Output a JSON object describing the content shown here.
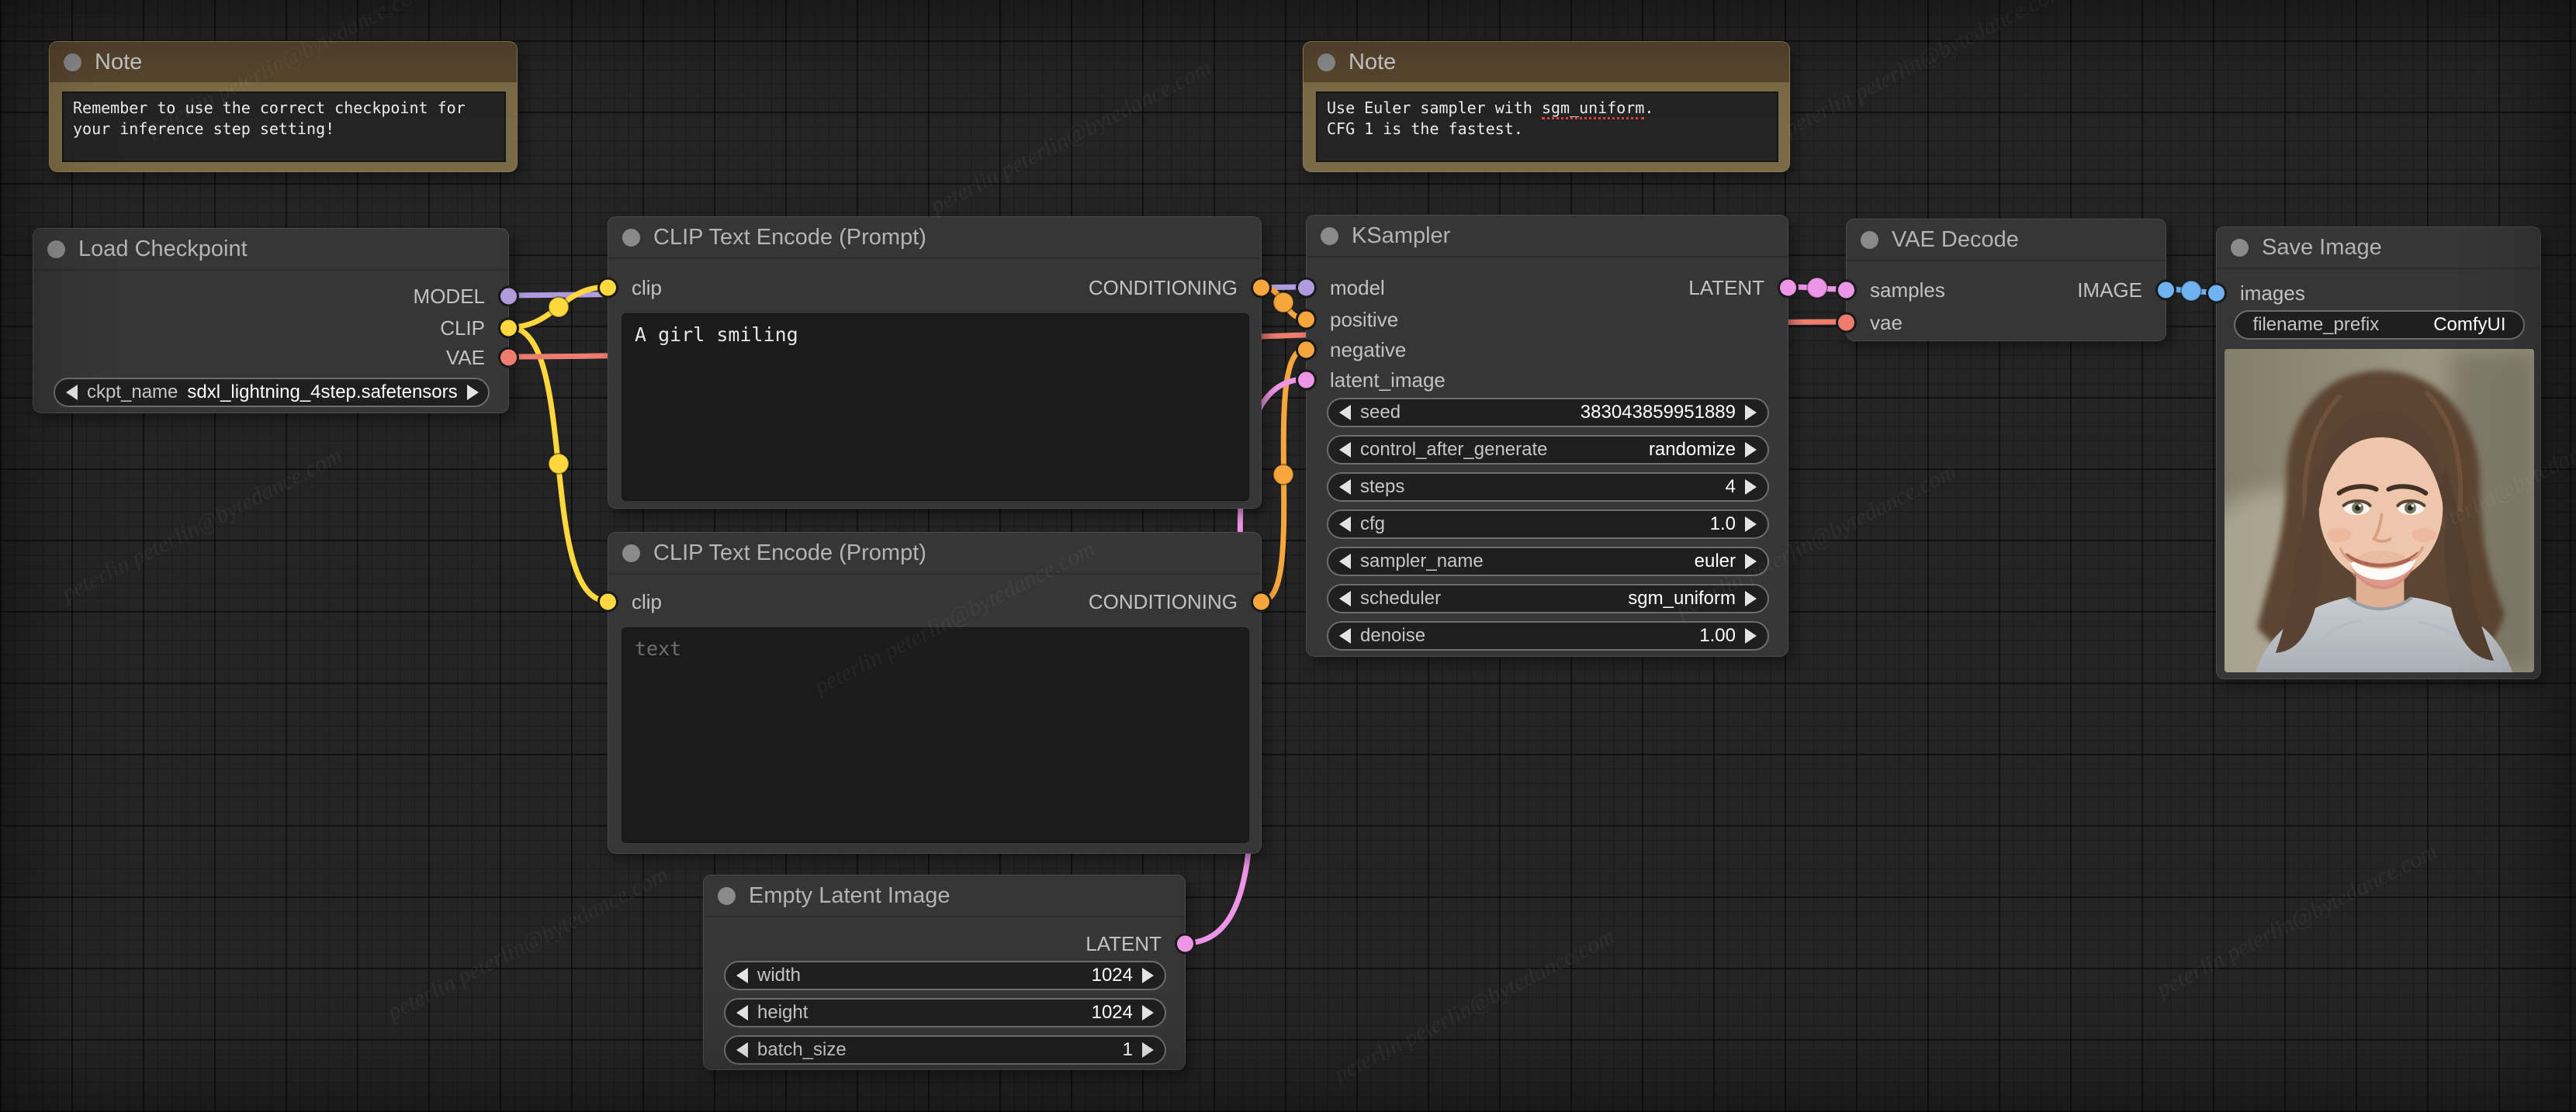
{
  "canvas": {
    "watermark_text": "peterlin peterlin@bytedance.com"
  },
  "colors": {
    "model": "#b19bdf",
    "clip": "#ffd83d",
    "vae": "#ee7d6f",
    "conditioning": "#f7a63d",
    "latent": "#ef95e7",
    "image": "#6fb3f2",
    "node_bg": "#363636",
    "note_header": "#57452e",
    "note_body": "#7a6a45",
    "title_dot": "#8a8a8a"
  },
  "nodes": {
    "note_left": {
      "title": "Note",
      "text": "Remember to use the correct checkpoint for your inference step setting!"
    },
    "note_right": {
      "title": "Note",
      "line1_pre": "Use Euler sampler with ",
      "line1_term": "sgm_uniform",
      "line1_post": ".",
      "line2": "CFG 1 is the fastest."
    },
    "load_checkpoint": {
      "title": "Load Checkpoint",
      "outputs": [
        "MODEL",
        "CLIP",
        "VAE"
      ],
      "widget": {
        "label": "ckpt_name",
        "value": "sdxl_lightning_4step.safetensors"
      }
    },
    "clip_text_encode_positive": {
      "title": "CLIP Text Encode (Prompt)",
      "input": "clip",
      "output": "CONDITIONING",
      "text": "A girl smiling"
    },
    "clip_text_encode_negative": {
      "title": "CLIP Text Encode (Prompt)",
      "input": "clip",
      "output": "CONDITIONING",
      "placeholder": "text"
    },
    "ksampler": {
      "title": "KSampler",
      "inputs": [
        "model",
        "positive",
        "negative",
        "latent_image"
      ],
      "output": "LATENT",
      "widgets": [
        {
          "label": "seed",
          "value": "383043859951889"
        },
        {
          "label": "control_after_generate",
          "value": "randomize"
        },
        {
          "label": "steps",
          "value": "4"
        },
        {
          "label": "cfg",
          "value": "1.0"
        },
        {
          "label": "sampler_name",
          "value": "euler"
        },
        {
          "label": "scheduler",
          "value": "sgm_uniform"
        },
        {
          "label": "denoise",
          "value": "1.00"
        }
      ]
    },
    "empty_latent_image": {
      "title": "Empty Latent Image",
      "output": "LATENT",
      "widgets": [
        {
          "label": "width",
          "value": "1024"
        },
        {
          "label": "height",
          "value": "1024"
        },
        {
          "label": "batch_size",
          "value": "1"
        }
      ]
    },
    "vae_decode": {
      "title": "VAE Decode",
      "inputs": [
        "samples",
        "vae"
      ],
      "output": "IMAGE"
    },
    "save_image": {
      "title": "Save Image",
      "input": "images",
      "widget": {
        "label": "filename_prefix",
        "value": "ComfyUI"
      }
    }
  }
}
